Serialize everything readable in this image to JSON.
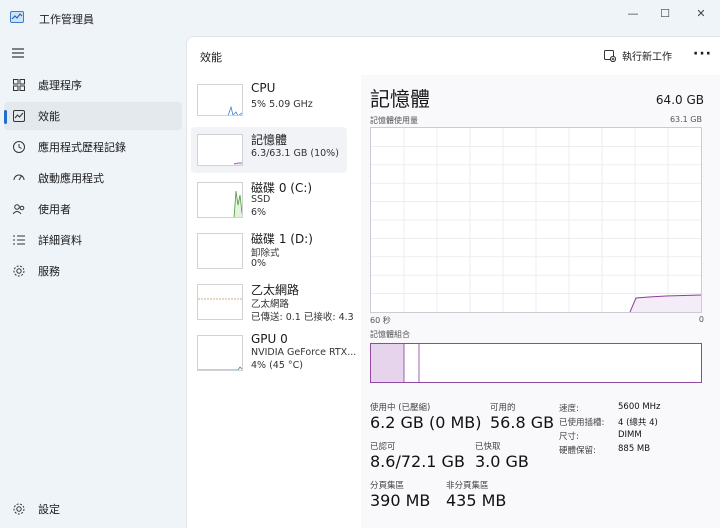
{
  "window": {
    "title": "工作管理員",
    "minimize_glyph": "—",
    "maximize_glyph": "☐",
    "close_glyph": "✕"
  },
  "sidebar": {
    "items": [
      {
        "label": "處理程序",
        "icon": "processes-icon"
      },
      {
        "label": "效能",
        "icon": "performance-icon",
        "active": true
      },
      {
        "label": "應用程式歷程記錄",
        "icon": "history-icon"
      },
      {
        "label": "啟動應用程式",
        "icon": "startup-icon"
      },
      {
        "label": "使用者",
        "icon": "users-icon"
      },
      {
        "label": "詳細資料",
        "icon": "details-icon"
      },
      {
        "label": "服務",
        "icon": "services-icon"
      }
    ],
    "settings_label": "設定"
  },
  "header": {
    "title": "效能",
    "run_task_label": "執行新工作",
    "more_glyph": "···"
  },
  "devices": [
    {
      "name": "CPU",
      "sub1": "5%  5.09 GHz",
      "sub2": "",
      "sub3": "",
      "color": "#3a80c8"
    },
    {
      "name": "記憶體",
      "sub1": "6.3/63.1 GB (10%)",
      "sub2": "",
      "sub3": "",
      "color": "#8b3f9e"
    },
    {
      "name": "磁碟 0 (C:)",
      "sub1": "SSD",
      "sub2": "6%",
      "sub3": "",
      "color": "#4c9a3a"
    },
    {
      "name": "磁碟 1 (D:)",
      "sub1": "卸除式",
      "sub2": "0%",
      "sub3": "",
      "color": "#4c9a3a"
    },
    {
      "name": "乙太網路",
      "sub1": "乙太網路",
      "sub2": "已傳送: 0.1  已接收: 4.3",
      "sub3": "",
      "color": "#a65c1e"
    },
    {
      "name": "GPU 0",
      "sub1": "NVIDIA GeForce RTX...",
      "sub2": "4% (45 °C)",
      "sub3": "",
      "color": "#2a8fa8"
    }
  ],
  "detail": {
    "title": "記憶體",
    "capacity": "64.0 GB",
    "usage_label": "記憶體使用量",
    "usage_max": "63.1 GB",
    "x_left": "60 秒",
    "x_right": "0",
    "composition_label": "記憶體組合",
    "stats": {
      "in_use_label": "使用中 (已壓縮)",
      "in_use_value": "6.2 GB (0 MB)",
      "available_label": "可用的",
      "available_value": "56.8 GB",
      "committed_label": "已認可",
      "committed_value": "8.6/72.1 GB",
      "cached_label": "已快取",
      "cached_value": "3.0 GB",
      "paged_label": "分頁集區",
      "paged_value": "390 MB",
      "nonpaged_label": "非分頁集區",
      "nonpaged_value": "435 MB"
    },
    "specs": [
      {
        "k": "速度:",
        "v": "5600 MHz"
      },
      {
        "k": "已使用插槽:",
        "v": "4 (總共 4)"
      },
      {
        "k": "尺寸:",
        "v": "DIMM"
      },
      {
        "k": "硬體保留:",
        "v": "885 MB"
      }
    ]
  }
}
